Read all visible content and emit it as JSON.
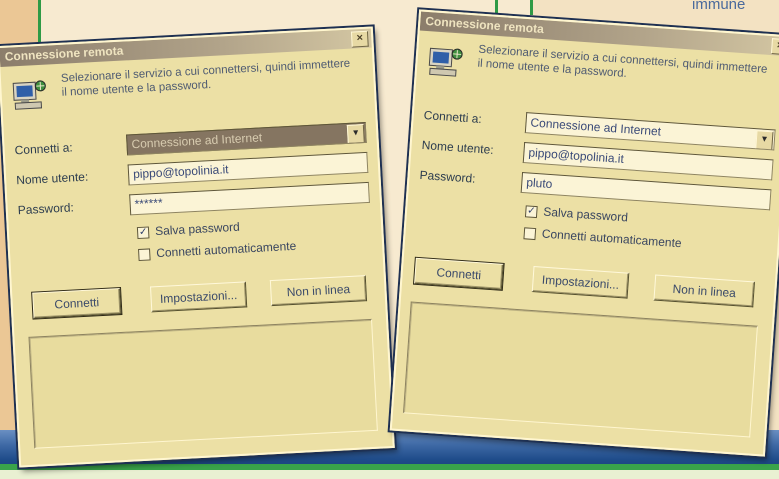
{
  "background": {
    "snippet_text": "immune"
  },
  "dialogs": [
    {
      "title": "Connessione remota",
      "close_label": "×",
      "instructions": "Selezionare il servizio a cui connettersi, quindi immettere il nome utente e la password.",
      "connect_to_label": "Connetti a:",
      "connect_to_value": "Connessione ad Internet",
      "username_label": "Nome utente:",
      "username_value": "pippo@topolinia.it",
      "password_label": "Password:",
      "password_value": "******",
      "save_password_label": "Salva password",
      "save_password_checked": true,
      "auto_connect_label": "Connetti automaticamente",
      "auto_connect_checked": false,
      "buttons": {
        "connect": "Connetti",
        "settings": "Impostazioni...",
        "offline": "Non in linea"
      }
    },
    {
      "title": "Connessione remota",
      "close_label": "×",
      "instructions": "Selezionare il servizio a cui connettersi, quindi immettere il nome utente e la password.",
      "connect_to_label": "Connetti a:",
      "connect_to_value": "Connessione ad Internet",
      "username_label": "Nome utente:",
      "username_value": "pippo@topolinia.it",
      "password_label": "Password:",
      "password_value": "pluto",
      "save_password_label": "Salva password",
      "save_password_checked": true,
      "auto_connect_label": "Connetti automaticamente",
      "auto_connect_checked": false,
      "buttons": {
        "connect": "Connetti",
        "settings": "Impostazioni...",
        "offline": "Non in linea"
      }
    }
  ]
}
